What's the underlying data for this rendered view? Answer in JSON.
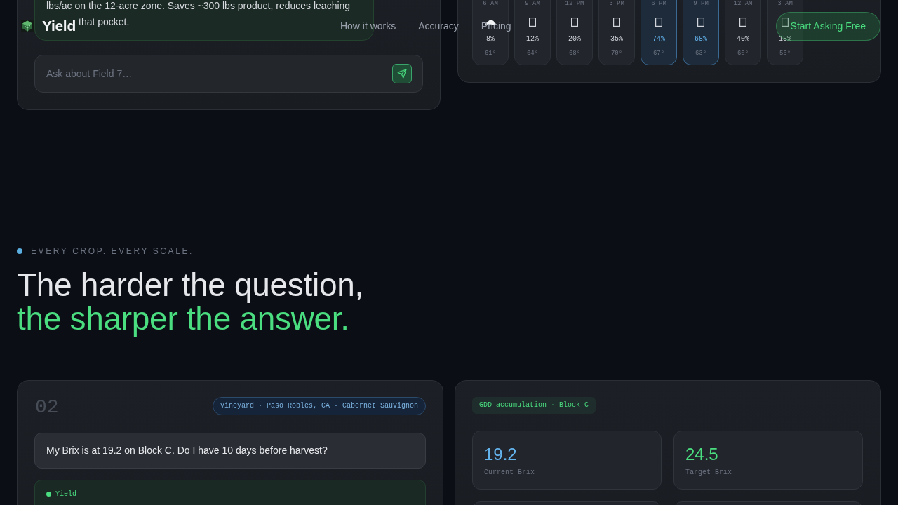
{
  "nav": {
    "brand": "Yield",
    "links": [
      {
        "label": "How it works"
      },
      {
        "label": "Accuracy"
      },
      {
        "label": "Pricing"
      }
    ],
    "cta": "Start Asking Free"
  },
  "field_chat": {
    "answer_lines": [
      "lbs/ac on the 12-acre zone. Saves ~300 lbs product, reduces leaching",
      "that pocket."
    ],
    "input": {
      "placeholder": "Ask about Field 7…"
    }
  },
  "forecast": {
    "hours": [
      {
        "time": "6 AM",
        "kind": "cloud",
        "chance": "8%",
        "temp": "61°",
        "highlighted": false
      },
      {
        "time": "9 AM",
        "kind": "glyph_box",
        "chance": "12%",
        "temp": "64°",
        "highlighted": false
      },
      {
        "time": "12 PM",
        "kind": "glyph_box",
        "chance": "20%",
        "temp": "68°",
        "highlighted": false
      },
      {
        "time": "3 PM",
        "kind": "glyph_box",
        "chance": "35%",
        "temp": "70°",
        "highlighted": false
      },
      {
        "time": "6 PM",
        "kind": "glyph_box",
        "chance": "74%",
        "temp": "67°",
        "highlighted": true
      },
      {
        "time": "9 PM",
        "kind": "glyph_box",
        "chance": "68%",
        "temp": "63°",
        "highlighted": true
      },
      {
        "time": "12 AM",
        "kind": "glyph_box",
        "chance": "40%",
        "temp": "60°",
        "highlighted": false
      },
      {
        "time": "3 AM",
        "kind": "glyph_box",
        "chance": "18%",
        "temp": "56°",
        "highlighted": false
      }
    ]
  },
  "section": {
    "eyebrow": "EVERY CROP. EVERY SCALE.",
    "headline": "The harder the question,",
    "headline_accent": "the sharper the answer."
  },
  "example": {
    "number": "02",
    "tag": "Vineyard · Paso Robles, CA · Cabernet Sauvignon",
    "question": "My Brix is at 19.2 on Block C. Do I have 10 days before harvest?",
    "answer_label": "Yield"
  },
  "gdd_panel": {
    "tag": "GDD accumulation · Block C",
    "stats": [
      {
        "value": "19.2",
        "label": "Current Brix",
        "color": "#63b3ed"
      },
      {
        "value": "24.5",
        "label": "Target Brix",
        "color": "#4ade80"
      }
    ]
  }
}
